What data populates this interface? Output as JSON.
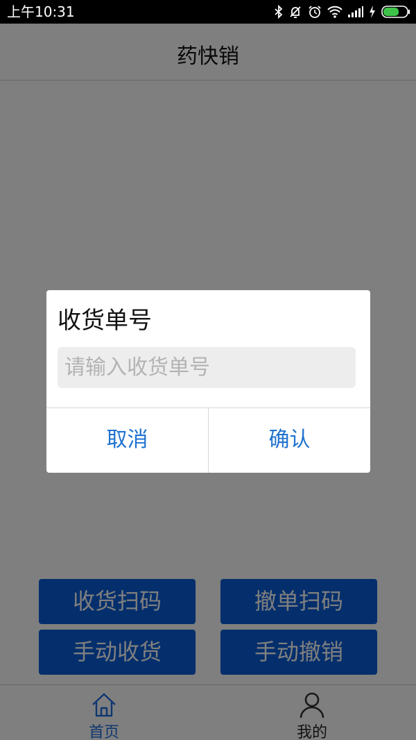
{
  "status_bar": {
    "time": "上午10:31",
    "icons": [
      "bluetooth-icon",
      "mute-bell-icon",
      "alarm-icon",
      "wifi-icon",
      "signal-icon",
      "charging-icon",
      "battery-icon"
    ]
  },
  "header": {
    "title": "药快销"
  },
  "actions": {
    "receive_scan": "收货扫码",
    "cancel_scan": "撤单扫码",
    "manual_receive": "手动收货",
    "manual_cancel": "手动撤销"
  },
  "tabs": [
    {
      "label": "首页",
      "icon": "home-icon",
      "active": true
    },
    {
      "label": "我的",
      "icon": "user-icon",
      "active": false
    }
  ],
  "dialog": {
    "title": "收货单号",
    "input_value": "",
    "input_placeholder": "请输入收货单号",
    "cancel_label": "取消",
    "confirm_label": "确认"
  },
  "colors": {
    "button_blue": "#0a5ed8",
    "accent": "#1f72cf",
    "overlay": "rgba(0,0,0,0.5)"
  }
}
